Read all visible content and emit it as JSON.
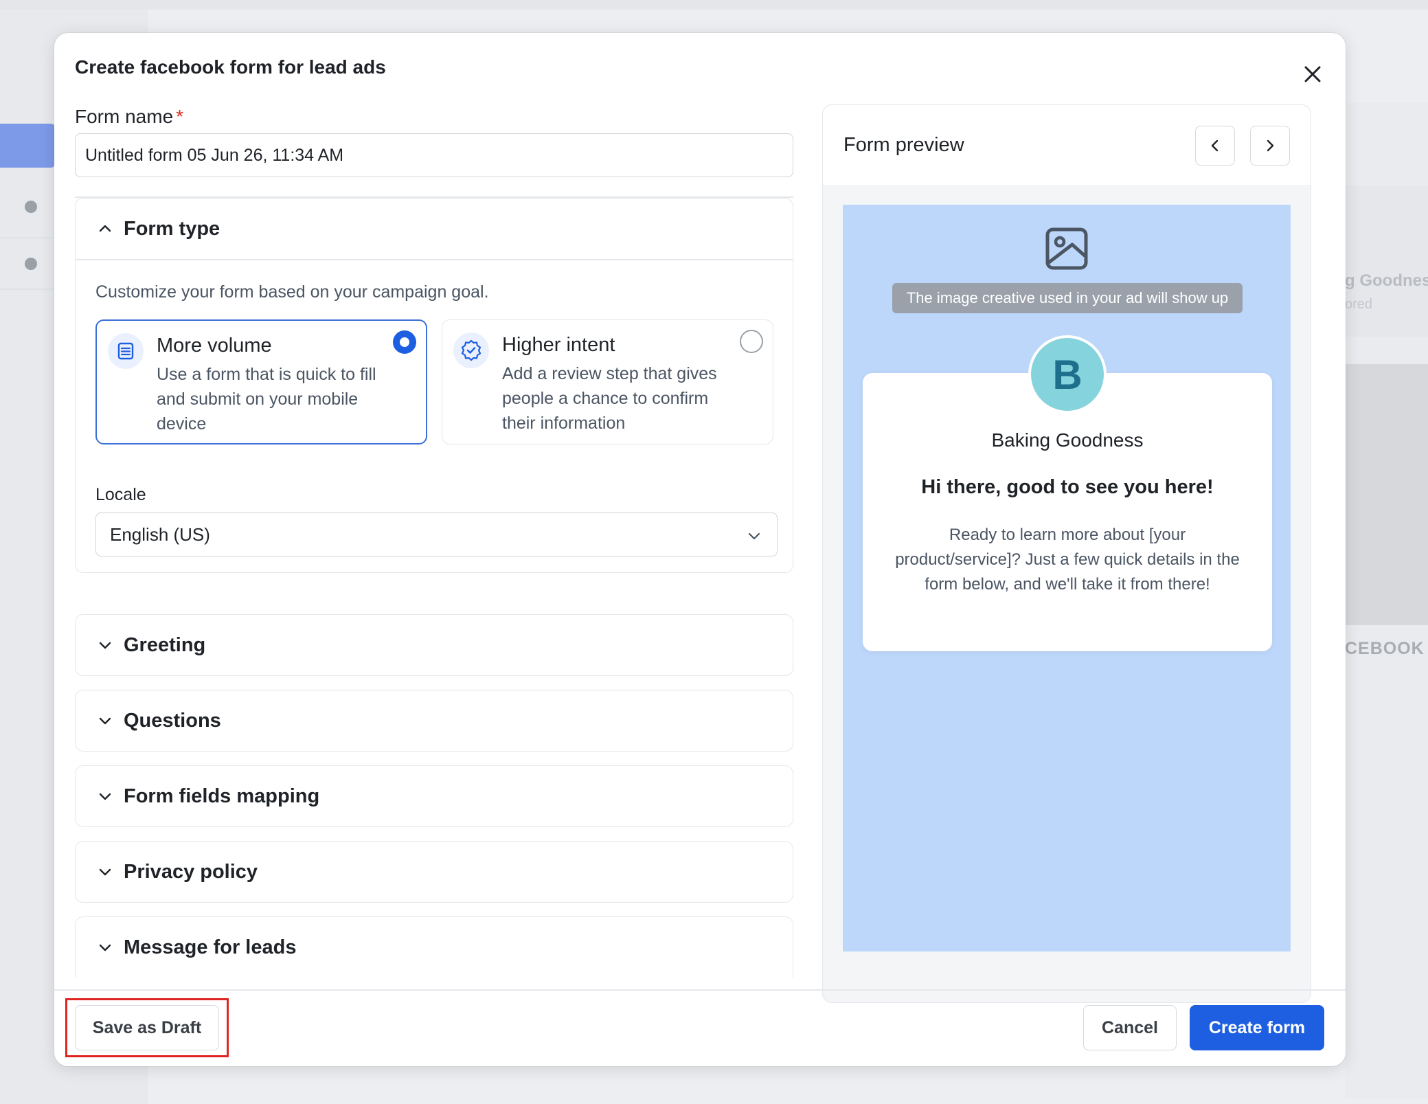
{
  "background": {
    "right_text_1": "g Goodnes",
    "right_text_2": "ored",
    "right_text_3": "CEBOOK"
  },
  "modal": {
    "title": "Create facebook form for lead ads",
    "form_name": {
      "label": "Form name",
      "required_mark": "*",
      "value": "Untitled form 05 Jun 26, 11:34 AM"
    },
    "form_type": {
      "title": "Form type",
      "description": "Customize your form based on your campaign goal.",
      "options": [
        {
          "title": "More volume",
          "description": "Use a form that is quick to fill and submit on your mobile device",
          "selected": true,
          "icon": "list-form-icon"
        },
        {
          "title": "Higher intent",
          "description": "Add a review step that gives people a chance to confirm their information",
          "selected": false,
          "icon": "verified-badge-icon"
        }
      ],
      "locale_label": "Locale",
      "locale_value": "English (US)"
    },
    "sections": [
      {
        "title": "Greeting"
      },
      {
        "title": "Questions"
      },
      {
        "title": "Form fields mapping"
      },
      {
        "title": "Privacy policy"
      },
      {
        "title": "Message for leads"
      }
    ],
    "preview": {
      "title": "Form preview",
      "image_caption": "The image creative used in your ad will show up",
      "avatar_letter": "B",
      "brand_name": "Baking Goodness",
      "greeting_headline": "Hi there, good to see you here!",
      "greeting_body": "Ready to learn more about [your product/service]? Just a few quick details in the form below, and we'll take it from there!"
    },
    "footer": {
      "save_draft": "Save as Draft",
      "cancel": "Cancel",
      "create": "Create form"
    }
  },
  "colors": {
    "primary": "#1d5fe0",
    "preview_bg": "#bdd7fb",
    "avatar_bg": "#85d3dc",
    "highlight": "#e02424"
  }
}
